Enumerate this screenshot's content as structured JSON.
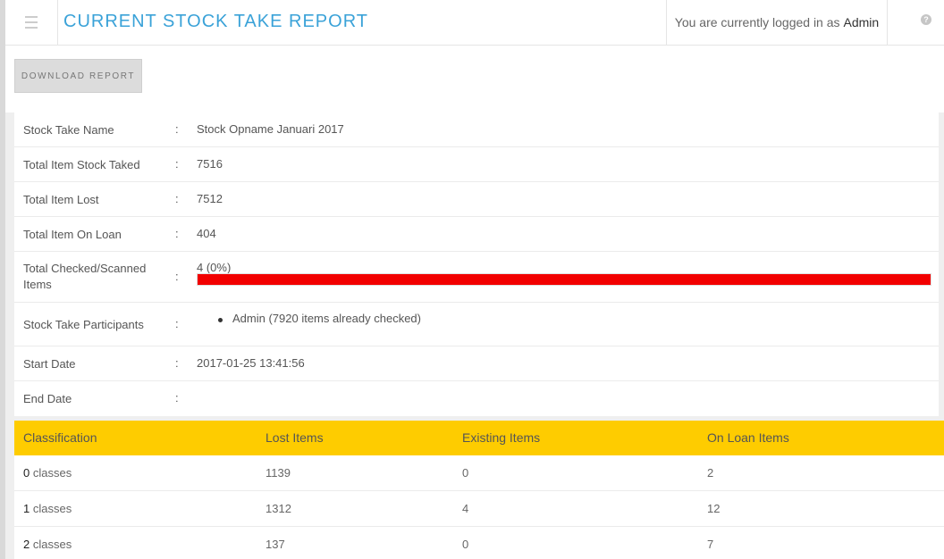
{
  "header": {
    "title": "CURRENT STOCK TAKE REPORT",
    "login_prefix": "You are currently logged in as",
    "user": "Admin",
    "help_glyph": "?"
  },
  "toolbar": {
    "download_label": "DOWNLOAD REPORT"
  },
  "colors": {
    "title": "#3aa2d8",
    "table_header": "#fecc00",
    "progress": "#f20000"
  },
  "report": {
    "stock_take_name": {
      "label": "Stock Take Name",
      "value": "Stock Opname Januari 2017"
    },
    "total_taked": {
      "label": "Total Item Stock Taked",
      "value": "7516"
    },
    "total_lost": {
      "label": "Total Item Lost",
      "value": "7512"
    },
    "total_on_loan": {
      "label": "Total Item On Loan",
      "value": "404"
    },
    "checked": {
      "label": "Total Checked/Scanned Items",
      "value": "4 (0%)",
      "progress_fraction": 0.0
    },
    "participants": {
      "label": "Stock Take Participants",
      "items": [
        "Admin (7920 items already checked)"
      ]
    },
    "start_date": {
      "label": "Start Date",
      "value": "2017-01-25 13:41:56"
    },
    "end_date": {
      "label": "End Date",
      "value": ""
    },
    "colon": ":"
  },
  "table": {
    "headers": [
      "Classification",
      "Lost Items",
      "Existing Items",
      "On Loan Items"
    ],
    "rows": [
      {
        "num": "0",
        "label": "classes",
        "lost": "1139",
        "existing": "0",
        "on_loan": "2"
      },
      {
        "num": "1",
        "label": "classes",
        "lost": "1312",
        "existing": "4",
        "on_loan": "12"
      },
      {
        "num": "2",
        "label": "classes",
        "lost": "137",
        "existing": "0",
        "on_loan": "7"
      }
    ]
  }
}
